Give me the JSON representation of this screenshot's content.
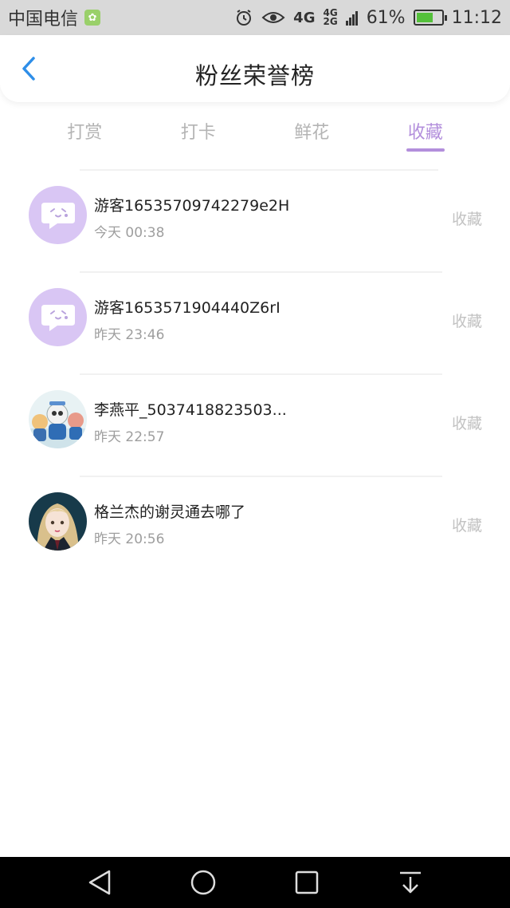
{
  "status_bar": {
    "carrier": "中国电信",
    "network_4g": "4G",
    "network_small_top": "4G",
    "network_small_bottom": "2G",
    "battery": "61%",
    "time": "11:12"
  },
  "header": {
    "title": "粉丝荣誉榜"
  },
  "tabs": [
    {
      "label": "打赏"
    },
    {
      "label": "打卡"
    },
    {
      "label": "鲜花"
    },
    {
      "label": "收藏"
    }
  ],
  "active_tab": "收藏",
  "list": [
    {
      "name": "游客16535709742279e2H",
      "time": "今天 00:38",
      "action": "收藏",
      "avatar": "default-chat-avatar"
    },
    {
      "name": "游客1653571904440Z6rI",
      "time": "昨天 23:46",
      "action": "收藏",
      "avatar": "default-chat-avatar"
    },
    {
      "name": "李燕平_5037418823503...",
      "time": "昨天 22:57",
      "action": "收藏",
      "avatar": "cartoon-group-photo"
    },
    {
      "name": "格兰杰的谢灵通去哪了",
      "time": "昨天 20:56",
      "action": "收藏",
      "avatar": "anime-girl-portrait"
    }
  ],
  "colors": {
    "accent": "#b38fdc",
    "avatar_default_bg": "#d9c6f4",
    "back_arrow": "#2e8ee8"
  }
}
